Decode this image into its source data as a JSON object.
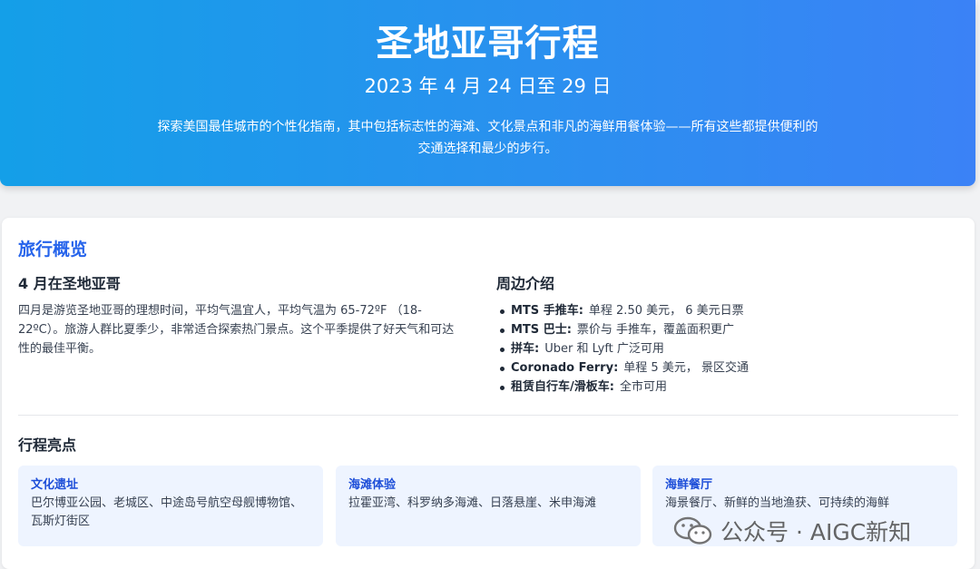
{
  "hero": {
    "title": "圣地亚哥行程",
    "date": "2023 年 4 月 24 日至 29 日",
    "intro": "探索美国最佳城市的个性化指南，其中包括标志性的海滩、文化景点和非凡的海鲜用餐体验——所有这些都提供便利的交通选择和最少的步行。"
  },
  "overview": {
    "title": "旅行概览",
    "april": {
      "heading": "4 月在圣地亚哥",
      "text": "四月是游览圣地亚哥的理想时间，平均气温宜人，平均气温为 65-72ºF （18-22ºC）。旅游人群比夏季少，非常适合探索热门景点。这个平季提供了好天气和可达性的最佳平衡。"
    },
    "transport": {
      "heading": "周边介绍",
      "items": [
        {
          "label": "MTS 手推车:",
          "text": "单程 2.50 美元， 6 美元日票"
        },
        {
          "label": "MTS 巴士:",
          "text": "票价与 手推车，覆盖面积更广"
        },
        {
          "label": "拼车:",
          "text": "Uber 和 Lyft 广泛可用"
        },
        {
          "label": "Coronado Ferry:",
          "text": "单程 5 美元， 景区交通"
        },
        {
          "label": "租赁自行车/滑板车:",
          "text": "全市可用"
        }
      ]
    }
  },
  "highlights": {
    "title": "行程亮点",
    "items": [
      {
        "title": "文化遗址",
        "text": "巴尔博亚公园、老城区、中途岛号航空母舰博物馆、瓦斯灯街区"
      },
      {
        "title": "海滩体验",
        "text": "拉霍亚湾、科罗纳多海滩、日落悬崖、米申海滩"
      },
      {
        "title": "海鲜餐厅",
        "text": "海景餐厅、新鲜的当地渔获、可持续的海鲜"
      }
    ]
  },
  "watermark": {
    "text": "公众号 · AIGC新知",
    "icon": "wechat-icon"
  }
}
